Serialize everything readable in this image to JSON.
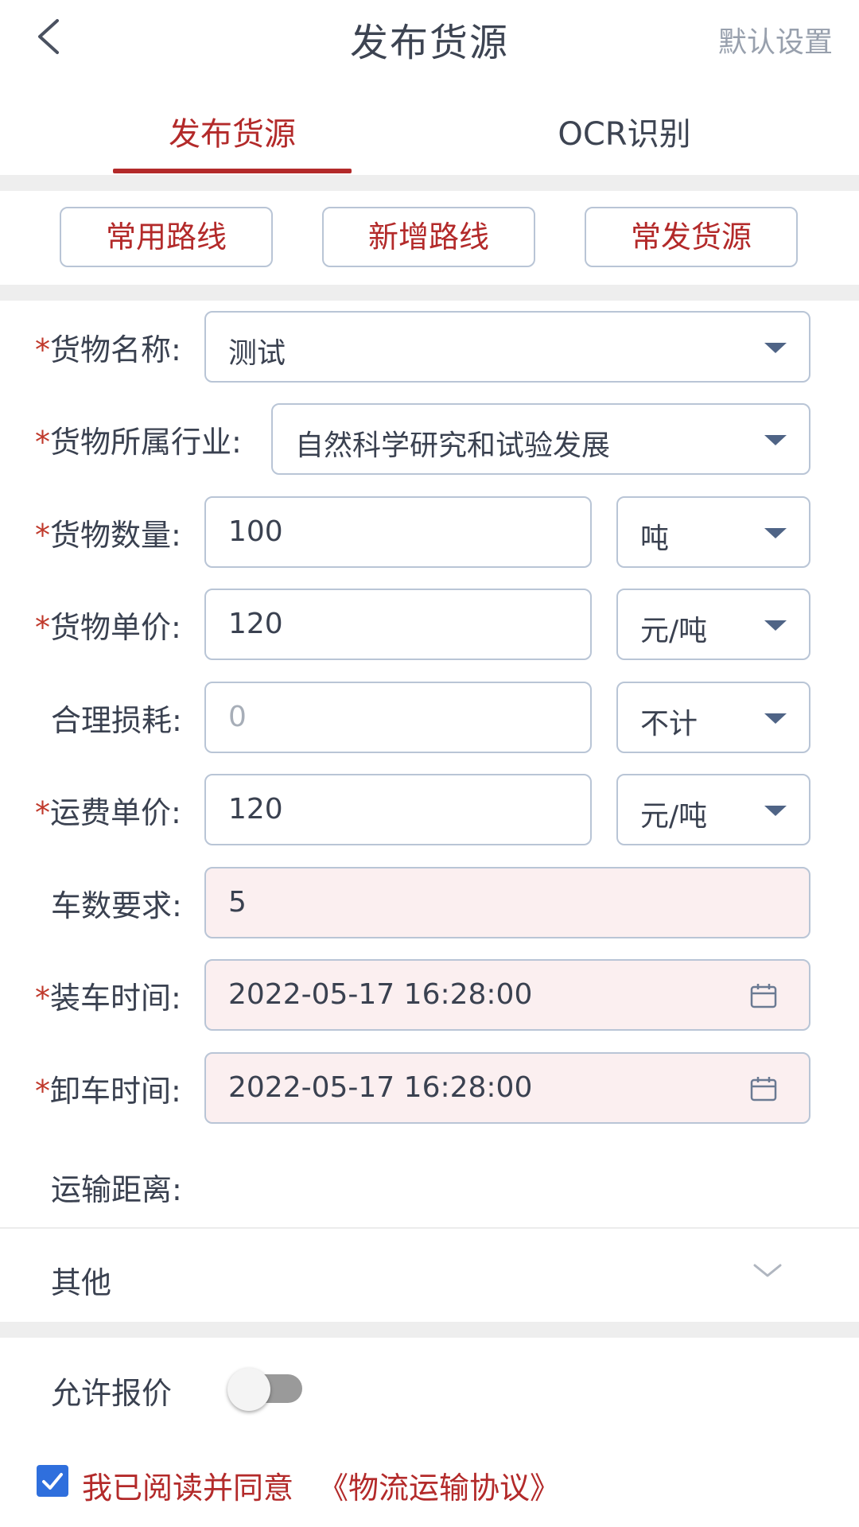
{
  "header": {
    "title": "发布货源",
    "default_settings": "默认设置"
  },
  "tabs": [
    {
      "label": "发布货源",
      "active": true
    },
    {
      "label": "OCR识别",
      "active": false
    }
  ],
  "route_buttons": [
    "常用路线",
    "新增路线",
    "常发货源"
  ],
  "form": {
    "required_mark": "*",
    "cargo_name": {
      "label": "货物名称:",
      "value": "测试"
    },
    "industry": {
      "label": "货物所属行业:",
      "value": "自然科学研究和试验发展"
    },
    "quantity": {
      "label": "货物数量:",
      "value": "100",
      "unit": "吨"
    },
    "unit_price": {
      "label": "货物单价:",
      "value": "120",
      "unit": "元/吨"
    },
    "loss": {
      "label": "合理损耗:",
      "placeholder": "0",
      "unit": "不计"
    },
    "freight_price": {
      "label": "运费单价:",
      "value": "120",
      "unit": "元/吨"
    },
    "truck_count": {
      "label": "车数要求:",
      "value": "5"
    },
    "load_time": {
      "label": "装车时间:",
      "value": "2022-05-17 16:28:00"
    },
    "unload_time": {
      "label": "卸车时间:",
      "value": "2022-05-17 16:28:00"
    },
    "distance": {
      "label": "运输距离:"
    }
  },
  "other": {
    "label": "其他"
  },
  "allow_quote": {
    "label": "允许报价",
    "enabled": false
  },
  "agreement": {
    "checked": true,
    "text": "我已阅读并同意",
    "link": "《物流运输协议》"
  },
  "colors": {
    "accent": "#b32a2a",
    "border": "#b9c5d6",
    "pink_field": "#fbeff0",
    "checkbox": "#2f6fdd"
  }
}
